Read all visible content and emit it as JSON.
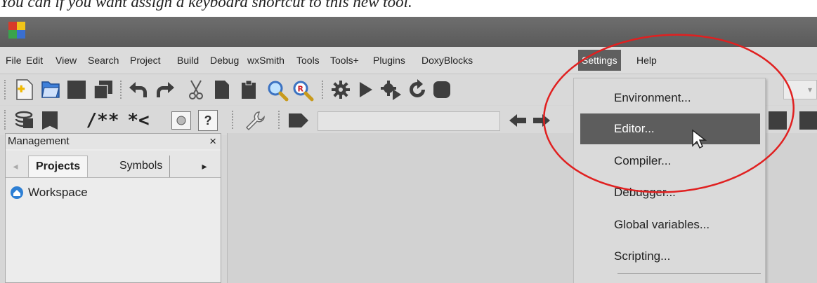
{
  "caption": "You can if you want assign a keyboard shortcut to this new tool.",
  "menubar": {
    "items": [
      {
        "label": "File",
        "key": "file"
      },
      {
        "label": "Edit",
        "key": "edit"
      },
      {
        "label": "View",
        "key": "view"
      },
      {
        "label": "Search",
        "key": "search"
      },
      {
        "label": "Project",
        "key": "project"
      },
      {
        "label": "Build",
        "key": "build"
      },
      {
        "label": "Debug",
        "key": "debug"
      },
      {
        "label": "wxSmith",
        "key": "wxsmith"
      },
      {
        "label": "Tools",
        "key": "tools"
      },
      {
        "label": "Tools+",
        "key": "tools-plus"
      },
      {
        "label": "Plugins",
        "key": "plugins"
      },
      {
        "label": "DoxyBlocks",
        "key": "doxyblocks"
      },
      {
        "label": "Settings",
        "key": "settings"
      },
      {
        "label": "Help",
        "key": "help"
      }
    ],
    "active": "Settings"
  },
  "toolbar2": {
    "doxy_block_label": "/**",
    "doxy_line_label": "*<"
  },
  "management": {
    "title": "Management",
    "close": "×",
    "tabs": [
      "Projects",
      "Symbols"
    ],
    "workspace_label": "Workspace"
  },
  "settings_menu": {
    "items": [
      "Environment...",
      "Editor...",
      "Compiler...",
      "Debugger...",
      "Global variables...",
      "Scripting..."
    ],
    "hovered": "Editor..."
  },
  "colors": {
    "titlebar": "#636363",
    "menu_active": "#5f5f5f",
    "annotation_oval": "#e02020",
    "workspace_icon": "#2d7fd4"
  }
}
